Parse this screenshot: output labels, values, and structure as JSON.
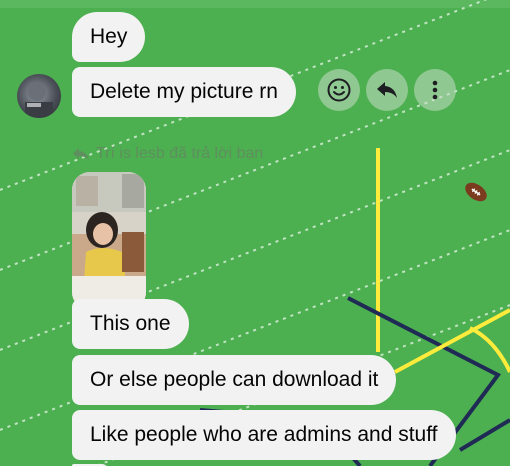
{
  "conversation": {
    "messages": [
      {
        "text": "Hey"
      },
      {
        "text": "Delete my picture rn"
      },
      {
        "text": "This one"
      },
      {
        "text": "Or else people can download it"
      },
      {
        "text": "Like people who are admins and stuff"
      }
    ],
    "reply_notice": "Trí is lesb đã trả lời bạn",
    "actions": {
      "react_icon": "smiley-icon",
      "reply_icon": "reply-arrow-icon",
      "more_icon": "more-vertical-icon"
    }
  },
  "theme": {
    "background": "#4caf50",
    "bubble": "#f1f2f1",
    "field_line_yellow": "#ffeb3b",
    "field_line_navy": "#1f2a55"
  }
}
